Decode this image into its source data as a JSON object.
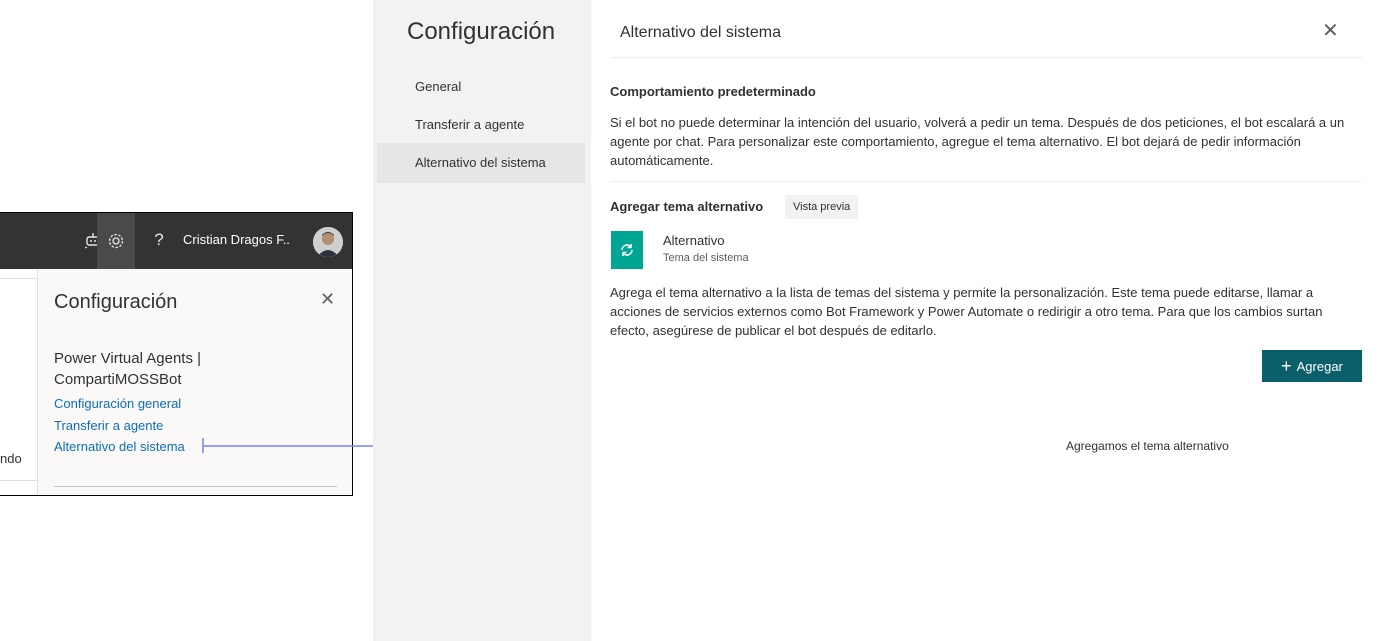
{
  "inset": {
    "topbar": {
      "user_name": "Cristian Dragos F..",
      "icons": [
        "bot-icon",
        "gear-icon",
        "help-icon"
      ],
      "help_glyph": "?"
    },
    "left_cut_text": "ndo",
    "panel": {
      "title": "Configuración",
      "bot_name": "Power Virtual Agents | CompartiMOSSBot",
      "links": [
        "Configuración general",
        "Transferir a agente",
        "Alternativo del sistema"
      ]
    }
  },
  "nav": {
    "title": "Configuración",
    "items": [
      "General",
      "Transferir a agente",
      "Alternativo del sistema"
    ],
    "selected_index": 2
  },
  "main": {
    "title": "Alternativo del sistema",
    "default_section": {
      "heading": "Comportamiento predeterminado",
      "text": "Si el bot no puede determinar la intención del usuario, volverá a pedir un tema. Después de dos peticiones, el bot escalará a un agente por chat. Para personalizar este comportamiento, agregue el tema alternativo. El bot dejará de pedir información automáticamente."
    },
    "add_section": {
      "heading": "Agregar tema alternativo",
      "badge": "Vista previa",
      "topic_name": "Alternativo",
      "topic_sub": "Tema del sistema",
      "text": "Agrega el tema alternativo a la lista de temas del sistema y permite la personalización. Este tema puede editarse, llamar a acciones de servicios externos como Bot Framework y Power Automate o redirigir a otro tema. Para que los cambios surtan efecto, asegúrese de publicar el bot después de editarlo.",
      "add_button_label": "Agregar"
    },
    "annotation": "Agregamos el tema alternativo"
  },
  "colors": {
    "accent_button": "#0b5f6b",
    "topic_icon": "#00a693",
    "annotation_arrow": "#7b83eb",
    "link": "#0f6cbd"
  }
}
